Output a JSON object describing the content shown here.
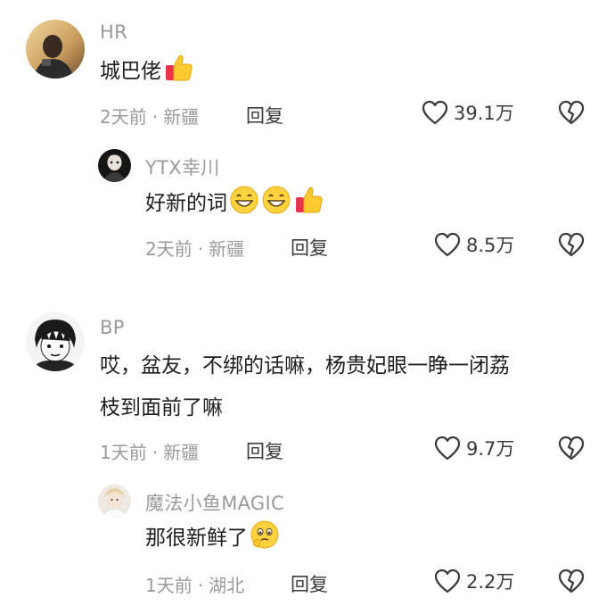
{
  "comments": [
    {
      "username": "HR",
      "text_lines": [
        "城巴佬"
      ],
      "emojis": [
        "thumbs-up"
      ],
      "time": "2天前",
      "separator": "·",
      "location": "新疆",
      "reply_label": "回复",
      "likes": "39.1万"
    },
    {
      "username": "YTX幸川",
      "text_lines": [
        "好新的词"
      ],
      "emojis": [
        "grinning-face",
        "grinning-face",
        "thumbs-up"
      ],
      "time": "2天前",
      "separator": "·",
      "location": "新疆",
      "reply_label": "回复",
      "likes": "8.5万"
    },
    {
      "username": "BP",
      "text_lines": [
        "哎，盆友，不绑的话嘛，杨贵妃眼一睁一闭荔",
        "枝到面前了嘛"
      ],
      "emojis": [],
      "time": "1天前",
      "separator": "·",
      "location": "新疆",
      "reply_label": "回复",
      "likes": "9.7万"
    },
    {
      "username": "魔法小鱼MAGIC",
      "text_lines": [
        "那很新鲜了"
      ],
      "emojis": [
        "face-holding-back-tears"
      ],
      "time": "1天前",
      "separator": "·",
      "location": "湖北",
      "reply_label": "回复",
      "likes": "2.2万"
    }
  ],
  "colors": {
    "meta_gray": "#9a9a9a",
    "text_dark": "#1e1e1e",
    "icon_dark": "#3a3a3a"
  }
}
